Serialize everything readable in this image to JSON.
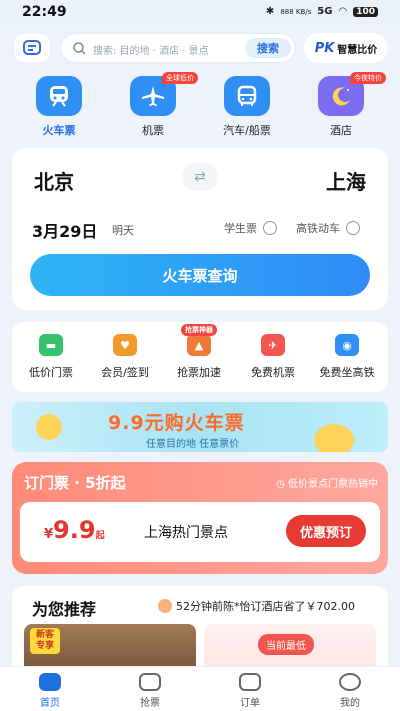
{
  "status": {
    "time": "22:49",
    "battery": "100",
    "net": "5G",
    "speed": "888 KB/s"
  },
  "search": {
    "placeholder": "搜索: 目的地 · 酒店 · 景点",
    "button": "搜索"
  },
  "pk": {
    "logo": "PK",
    "label": "智慧比价"
  },
  "categories": [
    {
      "label": "火车票",
      "color": "#2f8ff5",
      "badge": ""
    },
    {
      "label": "机票",
      "color": "#2f8ff5",
      "badge": "全球低价"
    },
    {
      "label": "汽车/船票",
      "color": "#2f8ff5",
      "badge": ""
    },
    {
      "label": "酒店",
      "color": "#7b6cf2",
      "badge": "今夜特价"
    }
  ],
  "booking": {
    "from": "北京",
    "to": "上海",
    "date": "3月29日",
    "day": "明天",
    "student": "学生票",
    "highspeed": "高铁动车",
    "query": "火车票查询"
  },
  "services": [
    {
      "label": "低价门票",
      "color": "#34c26a",
      "badge": ""
    },
    {
      "label": "会员/签到",
      "color": "#f19a2c",
      "badge": ""
    },
    {
      "label": "抢票加速",
      "color": "#f07a3a",
      "badge": "抢票神器"
    },
    {
      "label": "免费机票",
      "color": "#f2564f",
      "badge": ""
    },
    {
      "label": "免费坐高铁",
      "color": "#2f8ff5",
      "badge": ""
    }
  ],
  "banner": {
    "title": "9.9元购火车票",
    "sub": "任意目的地 任意票价"
  },
  "ticket": {
    "title": "订门票 · 5折起",
    "hot": "低价景点门票热销中",
    "currency": "¥",
    "price": "9.9",
    "qi": "起",
    "place": "上海热门景点",
    "book": "优惠预订"
  },
  "recommend": {
    "title": "为您推荐",
    "notice": "52分钟前陈*怡订酒店省了￥702.00",
    "tag1": "新客专享",
    "tag2": "当前最低"
  },
  "nav": [
    {
      "label": "首页"
    },
    {
      "label": "抢票"
    },
    {
      "label": "订单"
    },
    {
      "label": "我的"
    }
  ]
}
